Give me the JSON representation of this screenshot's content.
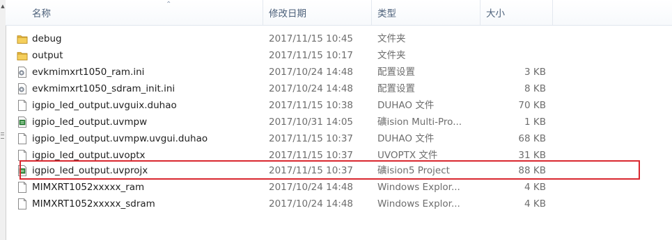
{
  "columns": {
    "name": "名称",
    "date": "修改日期",
    "type": "类型",
    "size": "大小"
  },
  "files": [
    {
      "name": "debug",
      "date": "2017/11/15 10:45",
      "type": "文件夹",
      "size": "",
      "icon": "folder-icon"
    },
    {
      "name": "output",
      "date": "2017/11/15 10:17",
      "type": "文件夹",
      "size": "",
      "icon": "folder-icon"
    },
    {
      "name": "evkmimxrt1050_ram.ini",
      "date": "2017/10/24 14:48",
      "type": "配置设置",
      "size": "3 KB",
      "icon": "ini-settings-icon"
    },
    {
      "name": "evkmimxrt1050_sdram_init.ini",
      "date": "2017/10/24 14:48",
      "type": "配置设置",
      "size": "8 KB",
      "icon": "ini-settings-icon"
    },
    {
      "name": "igpio_led_output.uvguix.duhao",
      "date": "2017/11/15 10:38",
      "type": "DUHAO 文件",
      "size": "70 KB",
      "icon": "blank-file-icon"
    },
    {
      "name": "igpio_led_output.uvmpw",
      "date": "2017/10/31 14:05",
      "type": "礦ision Multi-Pro...",
      "size": "1 KB",
      "icon": "uvision-file-icon"
    },
    {
      "name": "igpio_led_output.uvmpw.uvgui.duhao",
      "date": "2017/11/15 10:37",
      "type": "DUHAO 文件",
      "size": "68 KB",
      "icon": "blank-file-icon"
    },
    {
      "name": "igpio_led_output.uvoptx",
      "date": "2017/11/15 10:37",
      "type": "UVOPTX 文件",
      "size": "31 KB",
      "icon": "blank-file-icon"
    },
    {
      "name": "igpio_led_output.uvprojx",
      "date": "2017/11/15 10:37",
      "type": "礦ision5 Project",
      "size": "88 KB",
      "icon": "uvision-file-icon"
    },
    {
      "name": "MIMXRT1052xxxxx_ram",
      "date": "2017/10/24 14:48",
      "type": "Windows Explor...",
      "size": "4 KB",
      "icon": "blank-file-icon"
    },
    {
      "name": "MIMXRT1052xxxxx_sdram",
      "date": "2017/10/24 14:48",
      "type": "Windows Explor...",
      "size": "4 KB",
      "icon": "blank-file-icon"
    }
  ],
  "highlighted_file": "igpio_led_output.uvprojx",
  "colors": {
    "highlight_border": "#d9272e",
    "folder": "#e8b83f",
    "header_text": "#4c607a"
  }
}
